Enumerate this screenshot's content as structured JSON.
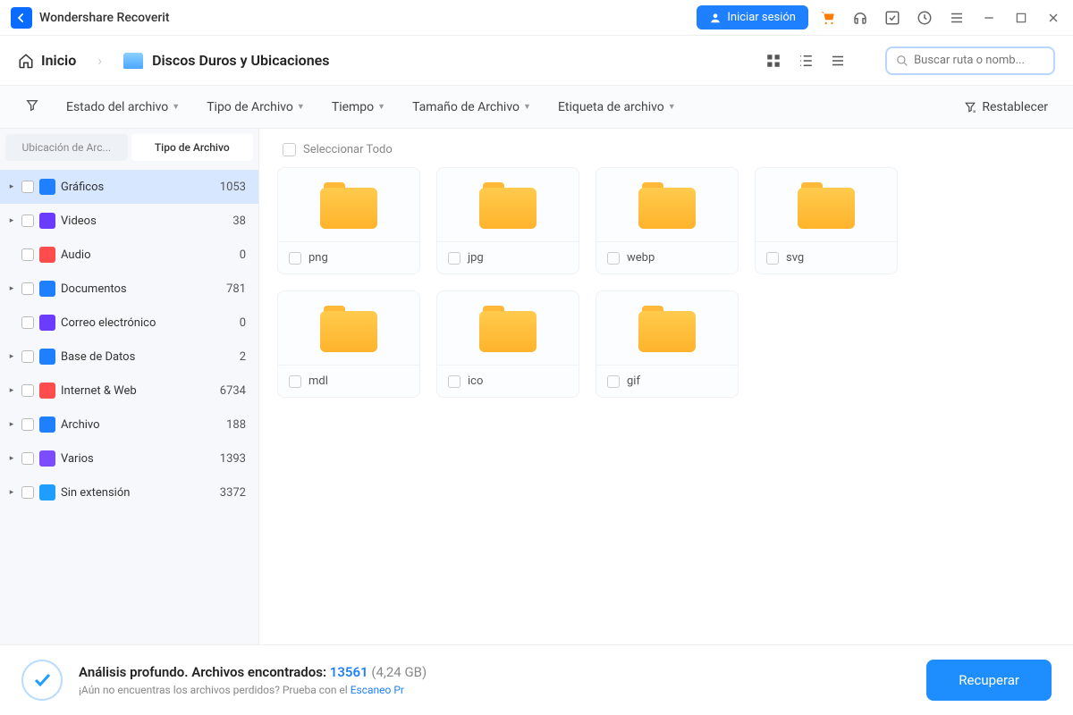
{
  "app": {
    "title": "Wondershare Recoverit"
  },
  "titlebar": {
    "login": "Iniciar sesión"
  },
  "nav": {
    "home": "Inicio",
    "location": "Discos Duros y Ubicaciones",
    "search_placeholder": "Buscar ruta o nomb..."
  },
  "filters": {
    "status": "Estado del archivo",
    "type": "Tipo de Archivo",
    "time": "Tiempo",
    "size": "Tamaño de Archivo",
    "tag": "Etiqueta de archivo",
    "reset": "Restablecer"
  },
  "sidebar": {
    "tab_location": "Ubicación de Arc...",
    "tab_type": "Tipo de Archivo",
    "cats": [
      {
        "label": "Gráficos",
        "count": "1053",
        "color": "#1e7fff",
        "caret": true,
        "selected": true
      },
      {
        "label": "Videos",
        "count": "38",
        "color": "#6b3bff",
        "caret": true
      },
      {
        "label": "Audio",
        "count": "0",
        "color": "#ff4d4d",
        "caret": false
      },
      {
        "label": "Documentos",
        "count": "781",
        "color": "#1e7fff",
        "caret": true
      },
      {
        "label": "Correo electrónico",
        "count": "0",
        "color": "#6b3bff",
        "caret": false
      },
      {
        "label": "Base de Datos",
        "count": "2",
        "color": "#1e7fff",
        "caret": true
      },
      {
        "label": "Internet & Web",
        "count": "6734",
        "color": "#ff4d4d",
        "caret": true
      },
      {
        "label": "Archivo",
        "count": "188",
        "color": "#1e7fff",
        "caret": true
      },
      {
        "label": "Varios",
        "count": "1393",
        "color": "#7b4dff",
        "caret": true
      },
      {
        "label": "Sin extensión",
        "count": "3372",
        "color": "#1e9fff",
        "caret": true
      }
    ]
  },
  "content": {
    "select_all": "Seleccionar Todo",
    "folders": [
      {
        "name": "png"
      },
      {
        "name": "jpg"
      },
      {
        "name": "webp"
      },
      {
        "name": "svg"
      },
      {
        "name": "mdl"
      },
      {
        "name": "ico"
      },
      {
        "name": "gif"
      }
    ]
  },
  "footer": {
    "line1_prefix": "Análisis profundo. Archivos encontrados: ",
    "count": "13561",
    "size": "(4,24 GB)",
    "line2_prefix": "¡Aún no encuentras los archivos perdidos? Prueba con el ",
    "line2_link": "Escaneo Pr",
    "recover": "Recuperar"
  }
}
